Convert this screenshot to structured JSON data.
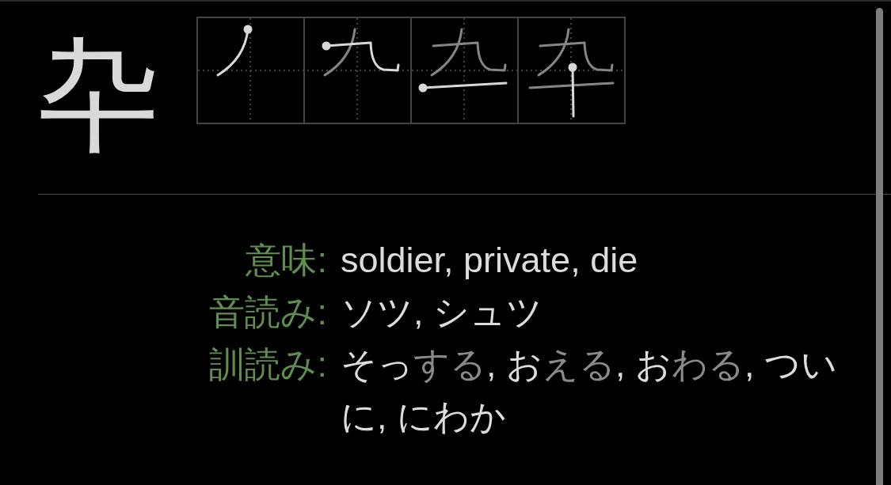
{
  "kanji": "卆",
  "details": [
    {
      "label": "意味:",
      "segments": [
        {
          "text": "soldier, private, die",
          "kind": "main"
        }
      ]
    },
    {
      "label": "音読み:",
      "segments": [
        {
          "text": "ソツ, シュツ",
          "kind": "main"
        }
      ]
    },
    {
      "label": "訓読み:",
      "segments": [
        {
          "text": "そっ",
          "kind": "main"
        },
        {
          "text": "する",
          "kind": "okurigana"
        },
        {
          "text": ", お",
          "kind": "main"
        },
        {
          "text": "える",
          "kind": "okurigana"
        },
        {
          "text": ", お",
          "kind": "main"
        },
        {
          "text": "わる",
          "kind": "okurigana"
        },
        {
          "text": ", ついに, にわか",
          "kind": "main"
        }
      ]
    }
  ]
}
